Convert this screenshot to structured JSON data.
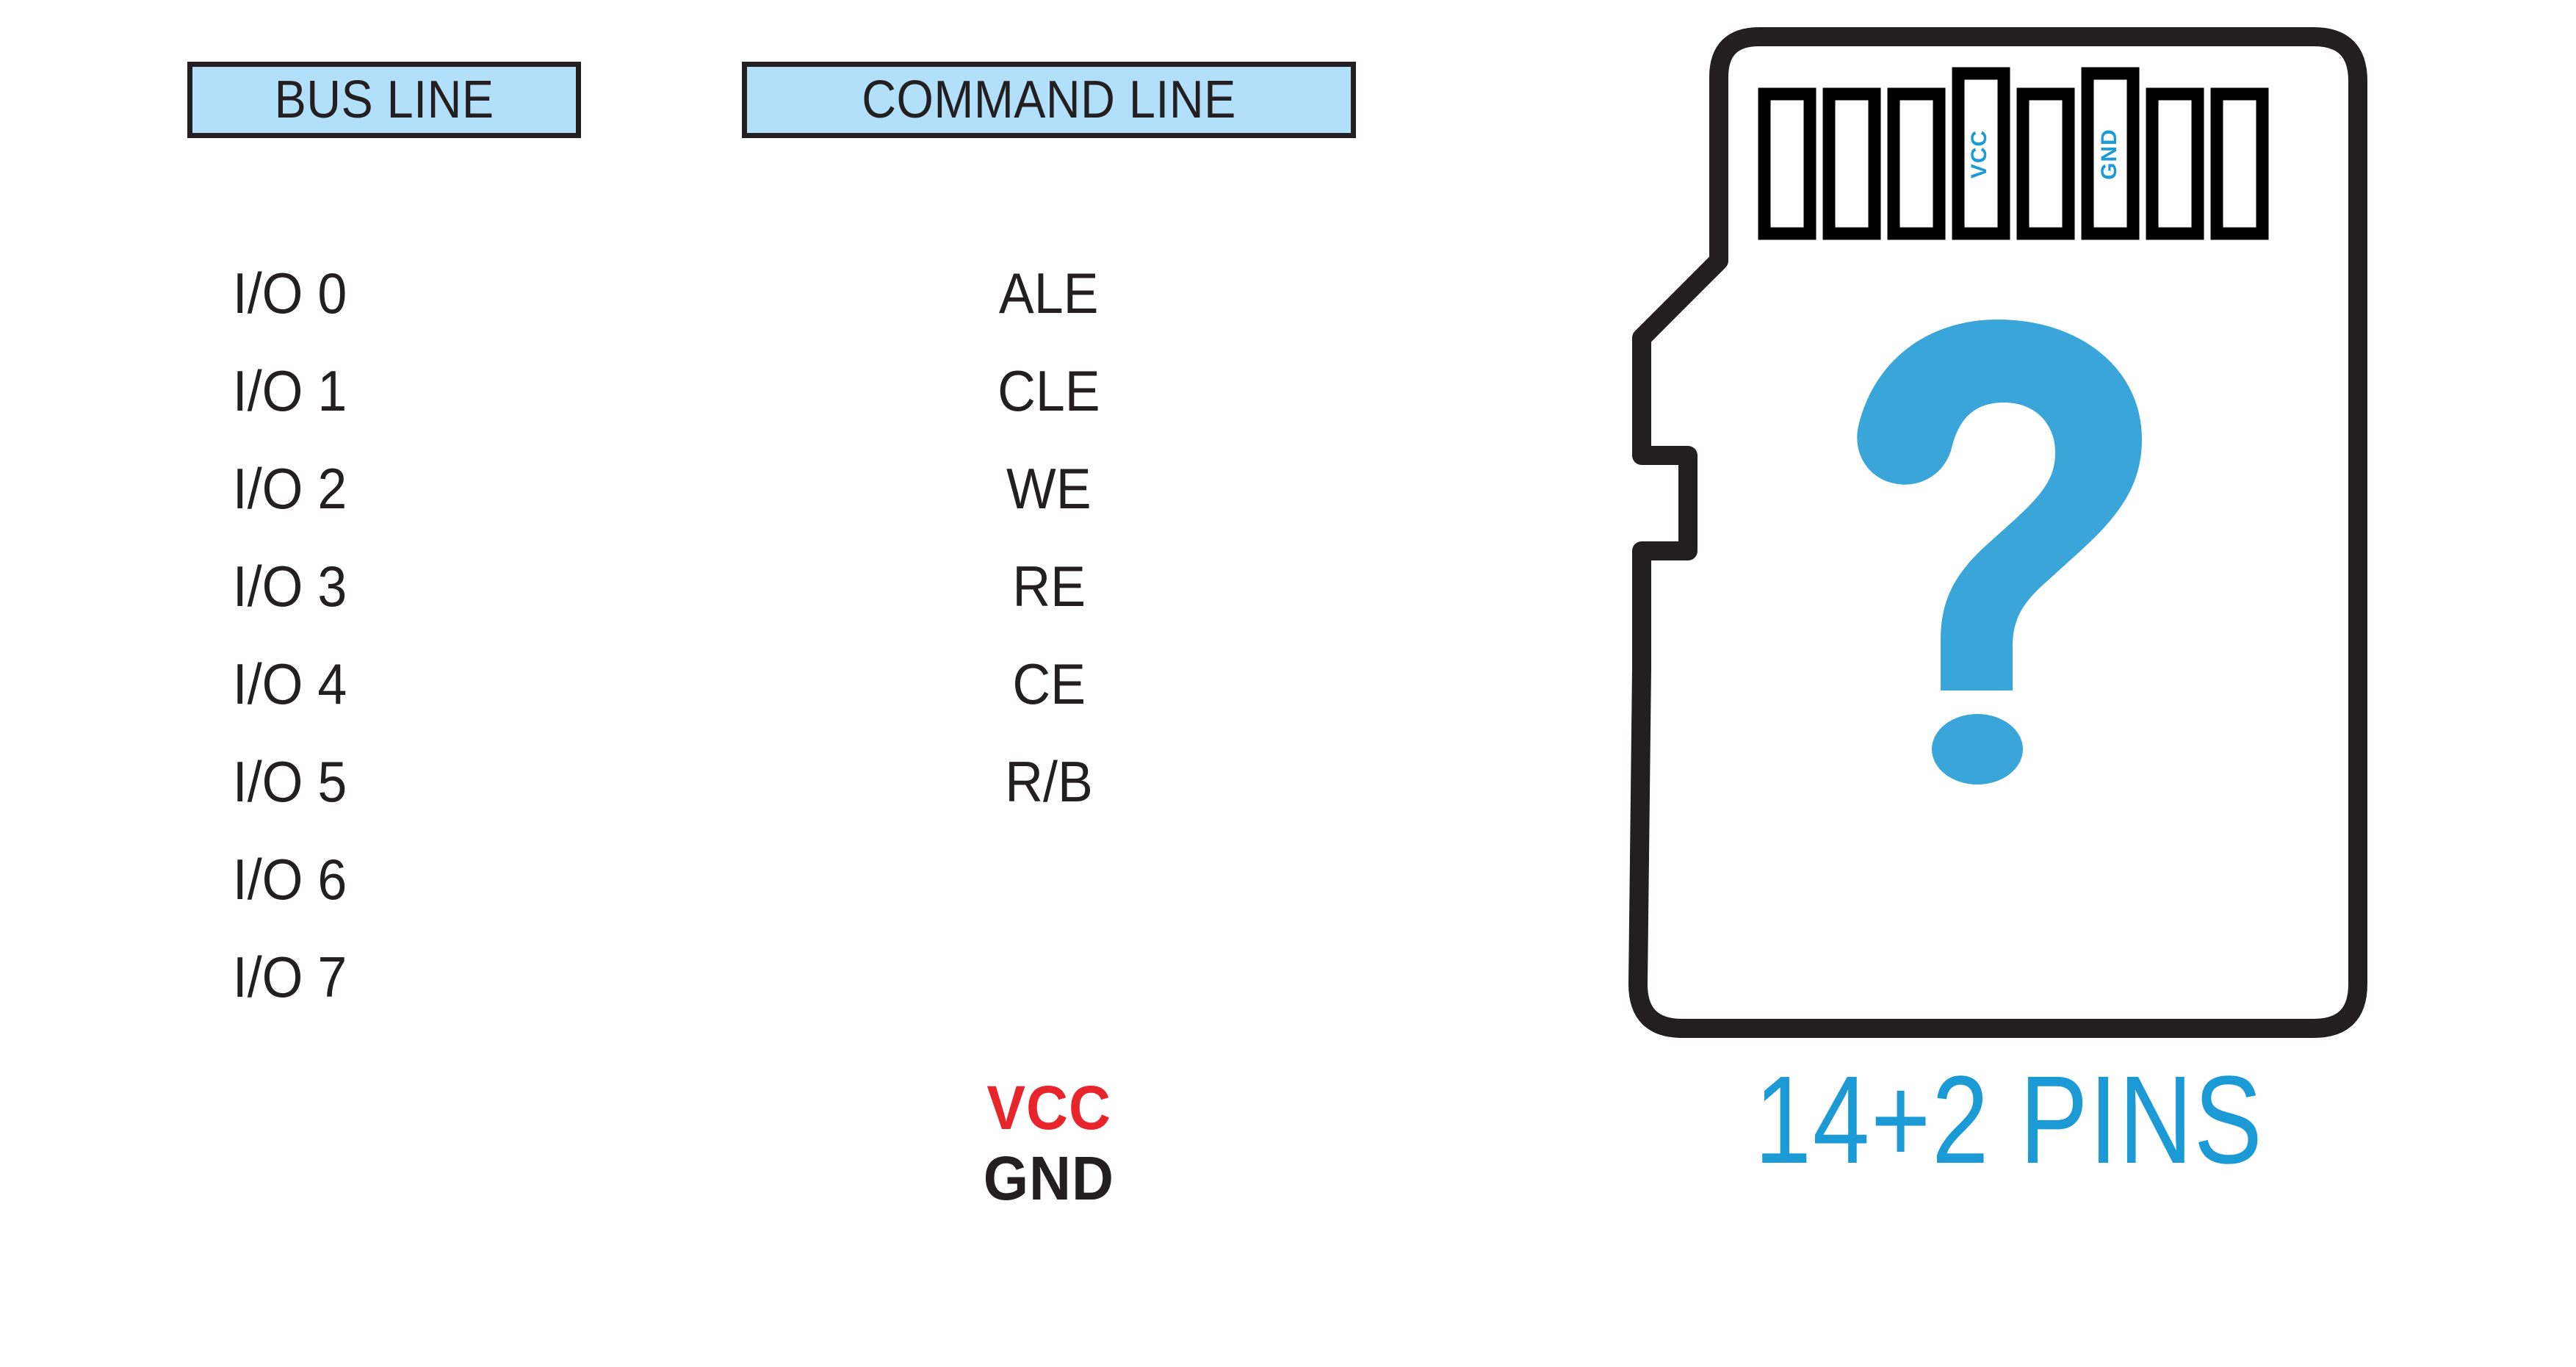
{
  "headers": {
    "bus_line": "BUS LINE",
    "command_line": "COMMAND LINE"
  },
  "bus_lines": [
    "I/O 0",
    "I/O 1",
    "I/O 2",
    "I/O 3",
    "I/O 4",
    "I/O 5",
    "I/O 6",
    "I/O 7"
  ],
  "command_lines": [
    "ALE",
    "CLE",
    "WE",
    "RE",
    "CE",
    "R/B"
  ],
  "power": {
    "vcc": "VCC",
    "gnd": "GND"
  },
  "card": {
    "caption": "14+2 PINS",
    "question_mark": "?",
    "pins": [
      {
        "index": 1,
        "label": "",
        "tall": false
      },
      {
        "index": 2,
        "label": "",
        "tall": false
      },
      {
        "index": 3,
        "label": "",
        "tall": false
      },
      {
        "index": 4,
        "label": "VCC",
        "tall": true
      },
      {
        "index": 5,
        "label": "",
        "tall": false
      },
      {
        "index": 6,
        "label": "GND",
        "tall": true
      },
      {
        "index": 7,
        "label": "",
        "tall": false
      },
      {
        "index": 8,
        "label": "",
        "tall": false
      }
    ]
  },
  "colors": {
    "header_fill": "#b2e0fa",
    "outline": "#231f20",
    "accent_blue": "#1b9ad6",
    "vcc_red": "#e8252a",
    "gnd_dark": "#231f20",
    "background": "#ffffff"
  }
}
